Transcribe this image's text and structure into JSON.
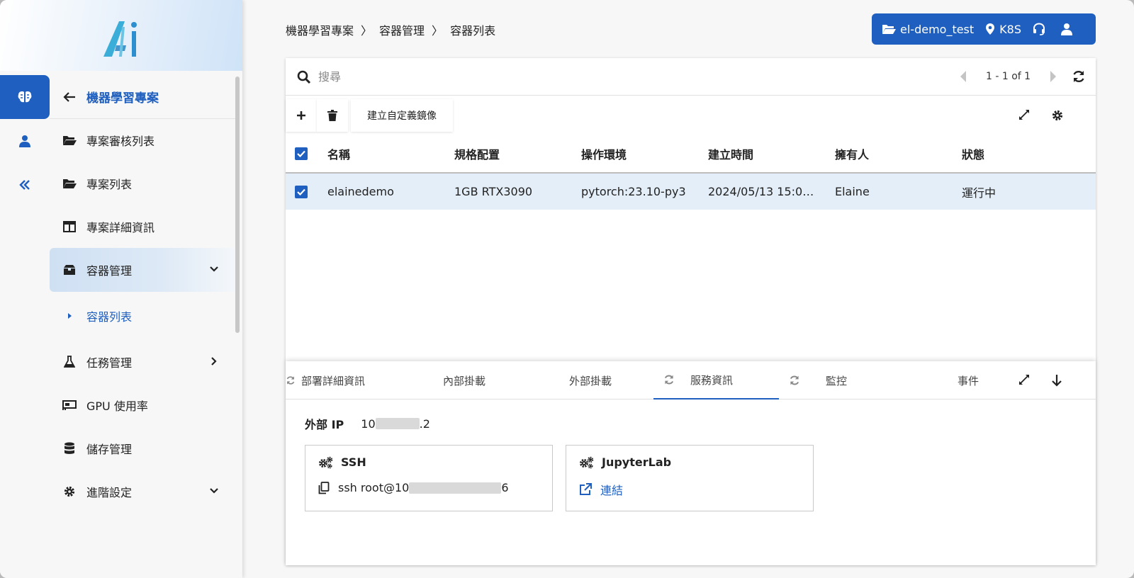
{
  "sidebar": {
    "back_label": "機器學習專案",
    "items": [
      {
        "label": "專案審核列表"
      },
      {
        "label": "專案列表"
      },
      {
        "label": "專案詳細資訊"
      },
      {
        "label": "容器管理"
      },
      {
        "label": "容器列表"
      },
      {
        "label": "任務管理"
      },
      {
        "label": "GPU 使用率"
      },
      {
        "label": "儲存管理"
      },
      {
        "label": "進階設定"
      }
    ]
  },
  "breadcrumb": [
    "機器學習專案",
    "〉",
    "容器管理",
    "〉",
    "容器列表"
  ],
  "topbar": {
    "project": "el-demo_test",
    "cluster": "K8S"
  },
  "toolbar": {
    "search_placeholder": "搜尋",
    "pager_text": "1 - 1 of 1",
    "create_image_label": "建立自定義鏡像"
  },
  "table": {
    "headers": [
      "名稱",
      "規格配置",
      "操作環境",
      "建立時間",
      "擁有人",
      "狀態"
    ],
    "rows": [
      [
        "elainedemo",
        "1GB RTX3090",
        "pytorch:23.10-py3",
        "2024/05/13 15:0…",
        "Elaine",
        "運行中"
      ]
    ]
  },
  "detail": {
    "tabs": [
      "部署詳細資訊",
      "內部掛載",
      "外部掛載",
      "服務資訊",
      "監控",
      "事件"
    ],
    "active_tab": "服務資訊",
    "external_ip_label": "外部 IP",
    "external_ip_prefix": "10",
    "external_ip_suffix": ".2",
    "ssh": {
      "title": "SSH",
      "command_prefix": "ssh root@10",
      "command_suffix": "6"
    },
    "jupyter": {
      "title": "JupyterLab",
      "link_label": "連結"
    }
  },
  "colors": {
    "accent": "#1f5fbf",
    "selected_row": "#e3eef8"
  }
}
